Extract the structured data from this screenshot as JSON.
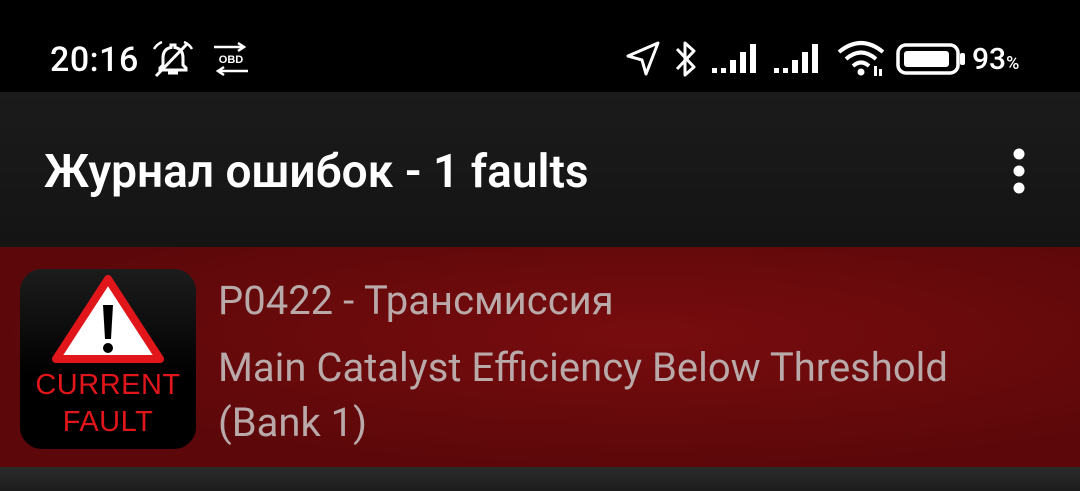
{
  "status_bar": {
    "time": "20:16",
    "obd_label": "OBD",
    "battery_value": "93",
    "battery_unit": "%",
    "icons": [
      "alarm-off-icon",
      "obd-transfer-icon",
      "location-arrow-icon",
      "bluetooth-icon",
      "signal-sim1-icon",
      "signal-sim2-icon",
      "wifi-icon",
      "battery-icon"
    ],
    "battery_level": 0.93
  },
  "app_bar": {
    "title": "Журнал ошибок - 1 faults",
    "menu_icon": "more-vertical-icon"
  },
  "faults": [
    {
      "badge_line_1": "CURRENT",
      "badge_line_2": "FAULT",
      "badge_icon": "warning-triangle-icon",
      "code_line": "P0422 - Трансмиссия",
      "description": "Main Catalyst Efficiency Below Threshold (Bank 1)"
    }
  ],
  "colors": {
    "status_bar_bg": "#000000",
    "app_bar_bg": "#161616",
    "fault_row_bg": "#780c0e",
    "fault_text": "#b9a9a9",
    "badge_red": "#e0161a"
  }
}
